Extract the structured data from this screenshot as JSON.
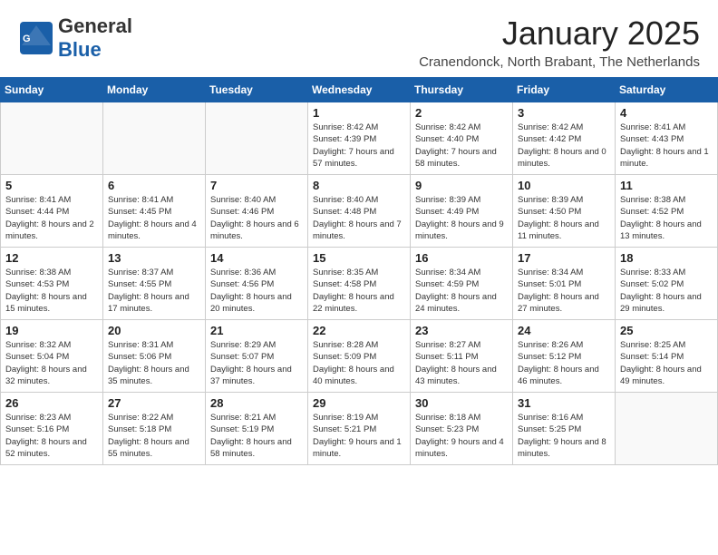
{
  "header": {
    "logo_general": "General",
    "logo_blue": "Blue",
    "month_title": "January 2025",
    "location": "Cranendonck, North Brabant, The Netherlands"
  },
  "weekdays": [
    "Sunday",
    "Monday",
    "Tuesday",
    "Wednesday",
    "Thursday",
    "Friday",
    "Saturday"
  ],
  "weeks": [
    [
      {
        "day": "",
        "content": ""
      },
      {
        "day": "",
        "content": ""
      },
      {
        "day": "",
        "content": ""
      },
      {
        "day": "1",
        "content": "Sunrise: 8:42 AM\nSunset: 4:39 PM\nDaylight: 7 hours and 57 minutes."
      },
      {
        "day": "2",
        "content": "Sunrise: 8:42 AM\nSunset: 4:40 PM\nDaylight: 7 hours and 58 minutes."
      },
      {
        "day": "3",
        "content": "Sunrise: 8:42 AM\nSunset: 4:42 PM\nDaylight: 8 hours and 0 minutes."
      },
      {
        "day": "4",
        "content": "Sunrise: 8:41 AM\nSunset: 4:43 PM\nDaylight: 8 hours and 1 minute."
      }
    ],
    [
      {
        "day": "5",
        "content": "Sunrise: 8:41 AM\nSunset: 4:44 PM\nDaylight: 8 hours and 2 minutes."
      },
      {
        "day": "6",
        "content": "Sunrise: 8:41 AM\nSunset: 4:45 PM\nDaylight: 8 hours and 4 minutes."
      },
      {
        "day": "7",
        "content": "Sunrise: 8:40 AM\nSunset: 4:46 PM\nDaylight: 8 hours and 6 minutes."
      },
      {
        "day": "8",
        "content": "Sunrise: 8:40 AM\nSunset: 4:48 PM\nDaylight: 8 hours and 7 minutes."
      },
      {
        "day": "9",
        "content": "Sunrise: 8:39 AM\nSunset: 4:49 PM\nDaylight: 8 hours and 9 minutes."
      },
      {
        "day": "10",
        "content": "Sunrise: 8:39 AM\nSunset: 4:50 PM\nDaylight: 8 hours and 11 minutes."
      },
      {
        "day": "11",
        "content": "Sunrise: 8:38 AM\nSunset: 4:52 PM\nDaylight: 8 hours and 13 minutes."
      }
    ],
    [
      {
        "day": "12",
        "content": "Sunrise: 8:38 AM\nSunset: 4:53 PM\nDaylight: 8 hours and 15 minutes."
      },
      {
        "day": "13",
        "content": "Sunrise: 8:37 AM\nSunset: 4:55 PM\nDaylight: 8 hours and 17 minutes."
      },
      {
        "day": "14",
        "content": "Sunrise: 8:36 AM\nSunset: 4:56 PM\nDaylight: 8 hours and 20 minutes."
      },
      {
        "day": "15",
        "content": "Sunrise: 8:35 AM\nSunset: 4:58 PM\nDaylight: 8 hours and 22 minutes."
      },
      {
        "day": "16",
        "content": "Sunrise: 8:34 AM\nSunset: 4:59 PM\nDaylight: 8 hours and 24 minutes."
      },
      {
        "day": "17",
        "content": "Sunrise: 8:34 AM\nSunset: 5:01 PM\nDaylight: 8 hours and 27 minutes."
      },
      {
        "day": "18",
        "content": "Sunrise: 8:33 AM\nSunset: 5:02 PM\nDaylight: 8 hours and 29 minutes."
      }
    ],
    [
      {
        "day": "19",
        "content": "Sunrise: 8:32 AM\nSunset: 5:04 PM\nDaylight: 8 hours and 32 minutes."
      },
      {
        "day": "20",
        "content": "Sunrise: 8:31 AM\nSunset: 5:06 PM\nDaylight: 8 hours and 35 minutes."
      },
      {
        "day": "21",
        "content": "Sunrise: 8:29 AM\nSunset: 5:07 PM\nDaylight: 8 hours and 37 minutes."
      },
      {
        "day": "22",
        "content": "Sunrise: 8:28 AM\nSunset: 5:09 PM\nDaylight: 8 hours and 40 minutes."
      },
      {
        "day": "23",
        "content": "Sunrise: 8:27 AM\nSunset: 5:11 PM\nDaylight: 8 hours and 43 minutes."
      },
      {
        "day": "24",
        "content": "Sunrise: 8:26 AM\nSunset: 5:12 PM\nDaylight: 8 hours and 46 minutes."
      },
      {
        "day": "25",
        "content": "Sunrise: 8:25 AM\nSunset: 5:14 PM\nDaylight: 8 hours and 49 minutes."
      }
    ],
    [
      {
        "day": "26",
        "content": "Sunrise: 8:23 AM\nSunset: 5:16 PM\nDaylight: 8 hours and 52 minutes."
      },
      {
        "day": "27",
        "content": "Sunrise: 8:22 AM\nSunset: 5:18 PM\nDaylight: 8 hours and 55 minutes."
      },
      {
        "day": "28",
        "content": "Sunrise: 8:21 AM\nSunset: 5:19 PM\nDaylight: 8 hours and 58 minutes."
      },
      {
        "day": "29",
        "content": "Sunrise: 8:19 AM\nSunset: 5:21 PM\nDaylight: 9 hours and 1 minute."
      },
      {
        "day": "30",
        "content": "Sunrise: 8:18 AM\nSunset: 5:23 PM\nDaylight: 9 hours and 4 minutes."
      },
      {
        "day": "31",
        "content": "Sunrise: 8:16 AM\nSunset: 5:25 PM\nDaylight: 9 hours and 8 minutes."
      },
      {
        "day": "",
        "content": ""
      }
    ]
  ]
}
